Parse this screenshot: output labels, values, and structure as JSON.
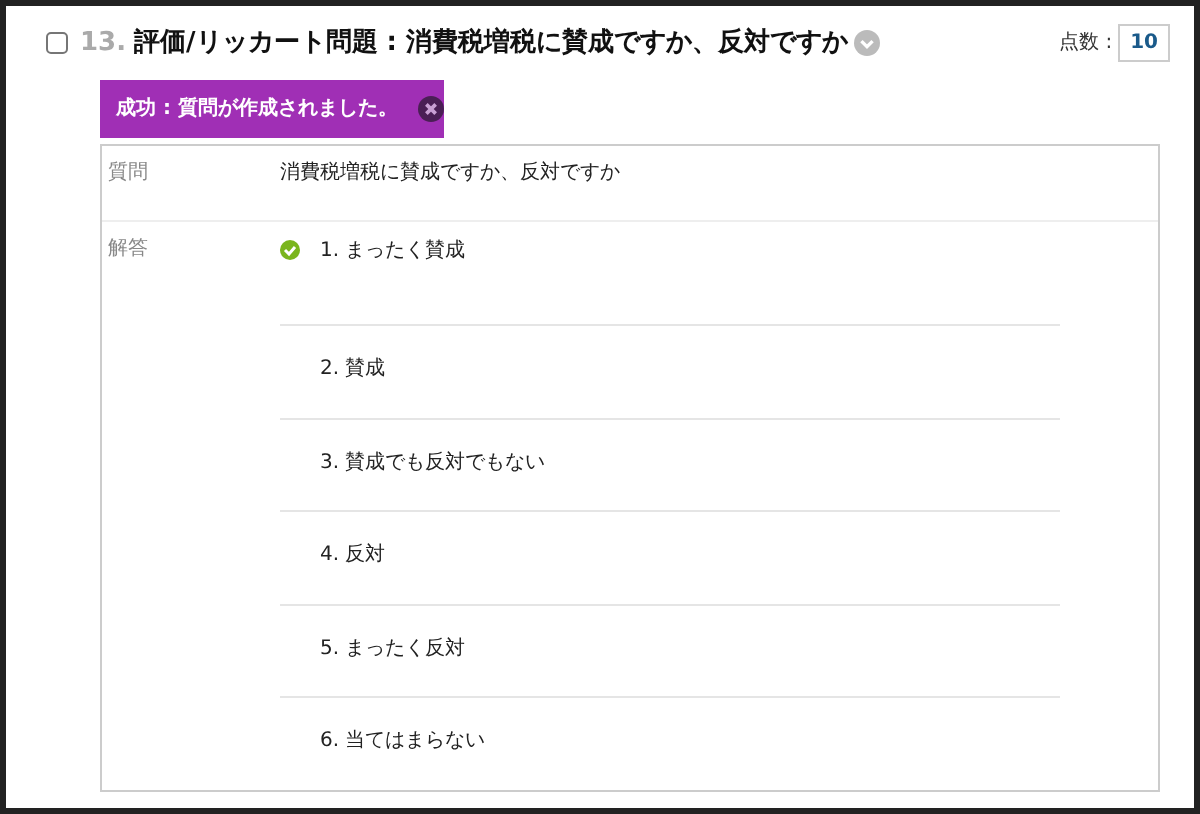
{
  "question": {
    "checked": false,
    "number": "13.",
    "title": "評価/リッカート問題 : 消費税増税に賛成ですか、反対ですか",
    "points_label": "点数 :",
    "points": "10"
  },
  "banner": {
    "text": "成功 : 質問が作成されました。"
  },
  "details": {
    "question_label": "質問",
    "question_text": "消費税増税に賛成ですか、反対ですか",
    "answer_label": "解答",
    "answers": [
      {
        "text": "1. まったく賛成",
        "correct": true
      },
      {
        "text": "2. 賛成",
        "correct": false
      },
      {
        "text": "3. 賛成でも反対でもない",
        "correct": false
      },
      {
        "text": "4. 反対",
        "correct": false
      },
      {
        "text": "5. まったく反対",
        "correct": false
      },
      {
        "text": "6. 当てはまらない",
        "correct": false
      }
    ]
  }
}
